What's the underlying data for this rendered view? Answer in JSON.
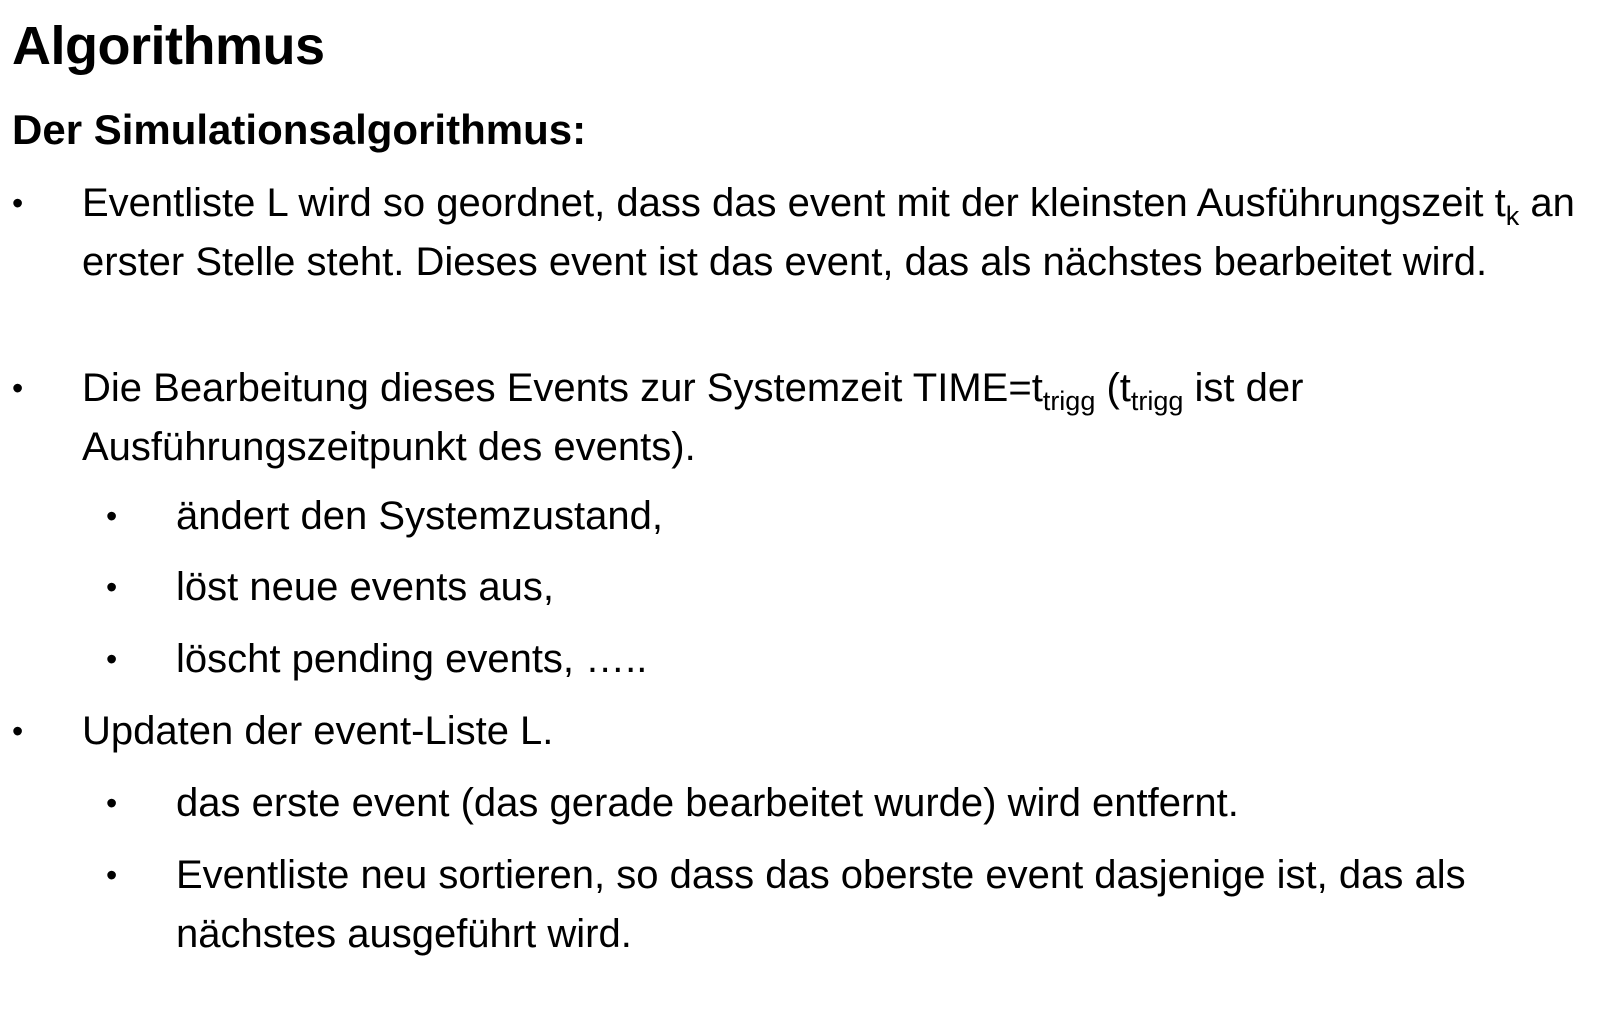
{
  "title": "Algorithmus",
  "subtitle": "Der Simulationsalgorithmus:",
  "bullet_symbol": "•",
  "items": [
    {
      "before": "Eventliste L wird so geordnet, dass das event mit der kleinsten Ausführungszeit t",
      "sub": "k",
      "after": " an erster Stelle steht. Dieses event ist das event, das als nächstes bearbeitet wird."
    },
    {
      "before": "Die Bearbeitung dieses Events zur Systemzeit TIME=t",
      "sub1": "trigg",
      "middle": " (t",
      "sub2": "trigg",
      "after": " ist der Ausführungszeitpunkt des events).",
      "subitems": [
        "ändert den Systemzustand,",
        "löst neue events aus,",
        "löscht pending events, ….."
      ]
    },
    {
      "text": "Updaten der event-Liste L.",
      "subitems": [
        "das erste event (das gerade bearbeitet wurde) wird entfernt.",
        "Eventliste neu sortieren, so dass das oberste event dasjenige ist, das als nächstes ausgeführt wird."
      ]
    }
  ]
}
